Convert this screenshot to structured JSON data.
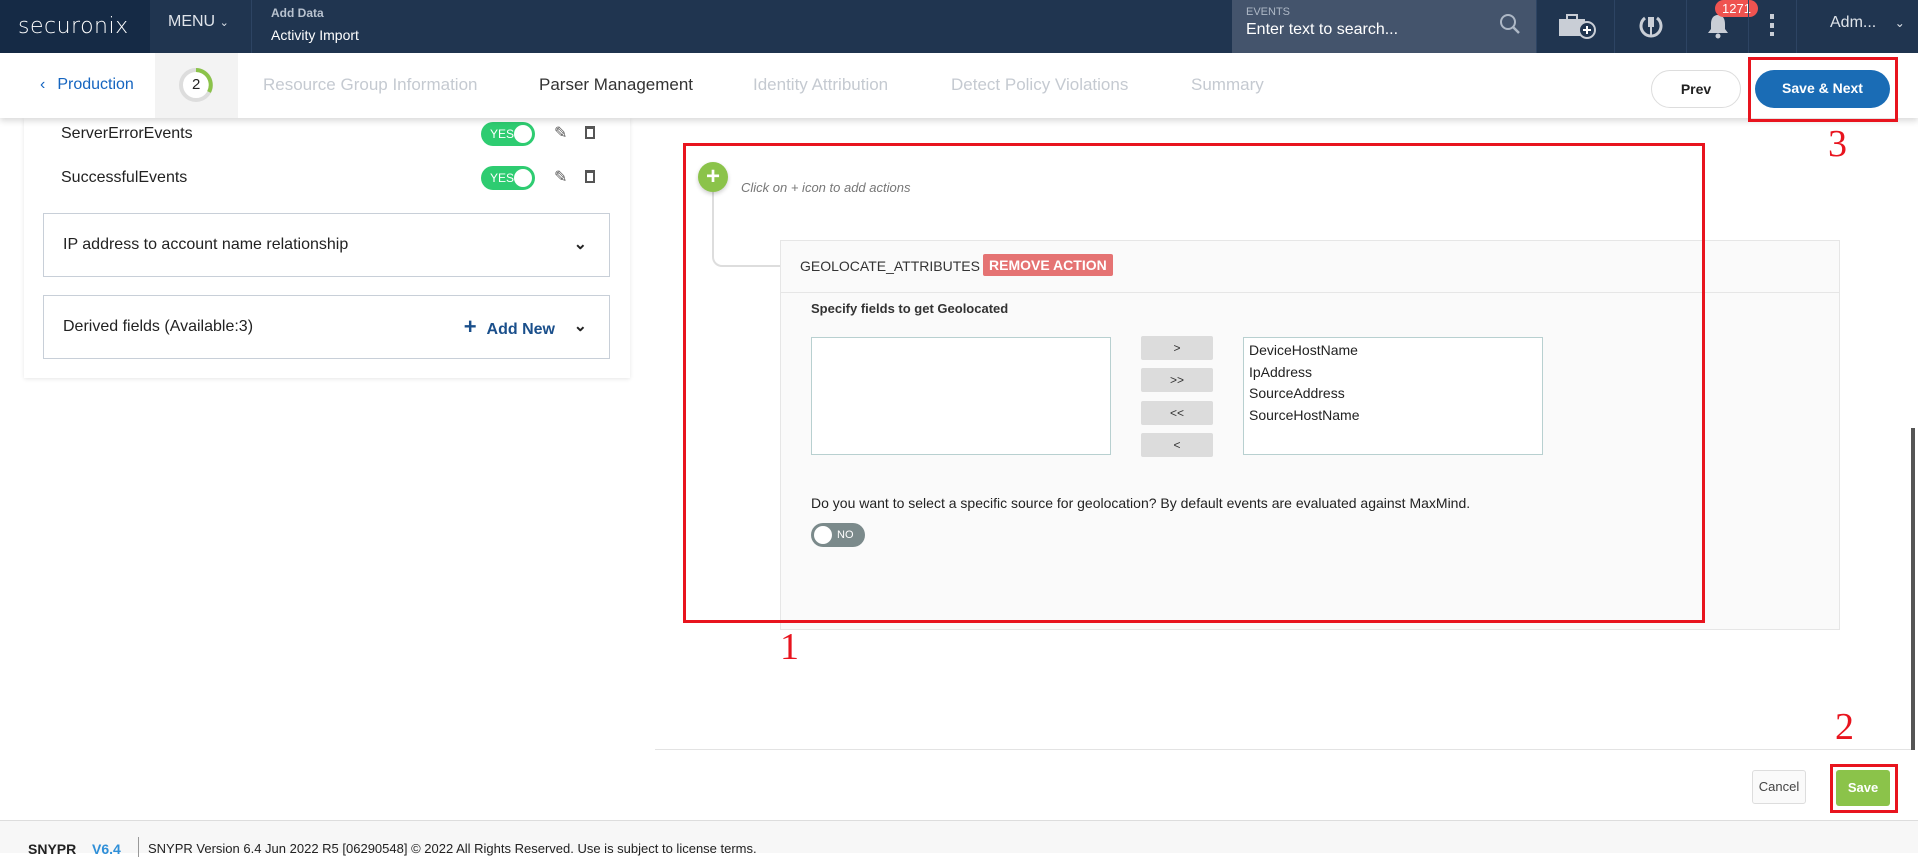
{
  "header": {
    "logo": "securonix",
    "menu": "MENU",
    "crumb_parent": "Add Data",
    "crumb_current": "Activity Import",
    "search_label": "EVENTS",
    "search_placeholder": "Enter text to search...",
    "notification_count": "1271",
    "user": "Adm..."
  },
  "stepper": {
    "back": "Production",
    "current_step": "2",
    "steps": [
      "Resource Group Information",
      "Parser Management",
      "Identity Attribution",
      "Detect Policy Violations",
      "Summary"
    ],
    "active_step": "Parser Management",
    "prev": "Prev",
    "save_next": "Save & Next"
  },
  "left": {
    "rows": [
      {
        "name": "ServerErrorEvents",
        "toggle": "YES"
      },
      {
        "name": "SuccessfulEvents",
        "toggle": "YES"
      }
    ],
    "ip_section": "IP address to account name relationship",
    "derived": "Derived fields (Available:3)",
    "add_new": "Add New"
  },
  "action": {
    "hint": "Click on + icon to add actions",
    "name": "GEOLOCATE_ATTRIBUTES",
    "remove": "REMOVE ACTION",
    "specify": "Specify fields to get Geolocated",
    "available": [],
    "selected": [
      "DeviceHostName",
      "IpAddress",
      "SourceAddress",
      "SourceHostName"
    ],
    "move_buttons": [
      ">",
      ">>",
      "<<",
      "<"
    ],
    "question": "Do you want to select a specific source for geolocation? By default events are evaluated against MaxMind.",
    "source_toggle": "NO"
  },
  "footer_buttons": {
    "cancel": "Cancel",
    "save": "Save"
  },
  "annotations": [
    "1",
    "2",
    "3"
  ],
  "footer": {
    "brand": "SNYPR",
    "version": "V6.4",
    "text": "SNYPR Version 6.4 Jun 2022 R5  [06290548] © 2022 All Rights Reserved. Use is subject to license terms."
  },
  "colors": {
    "header": "#203550",
    "accent": "#1a6cb5",
    "success": "#8bc34a",
    "toggle_on": "#2ecc71",
    "remove": "#e57373",
    "annotation": "#e8141e"
  }
}
